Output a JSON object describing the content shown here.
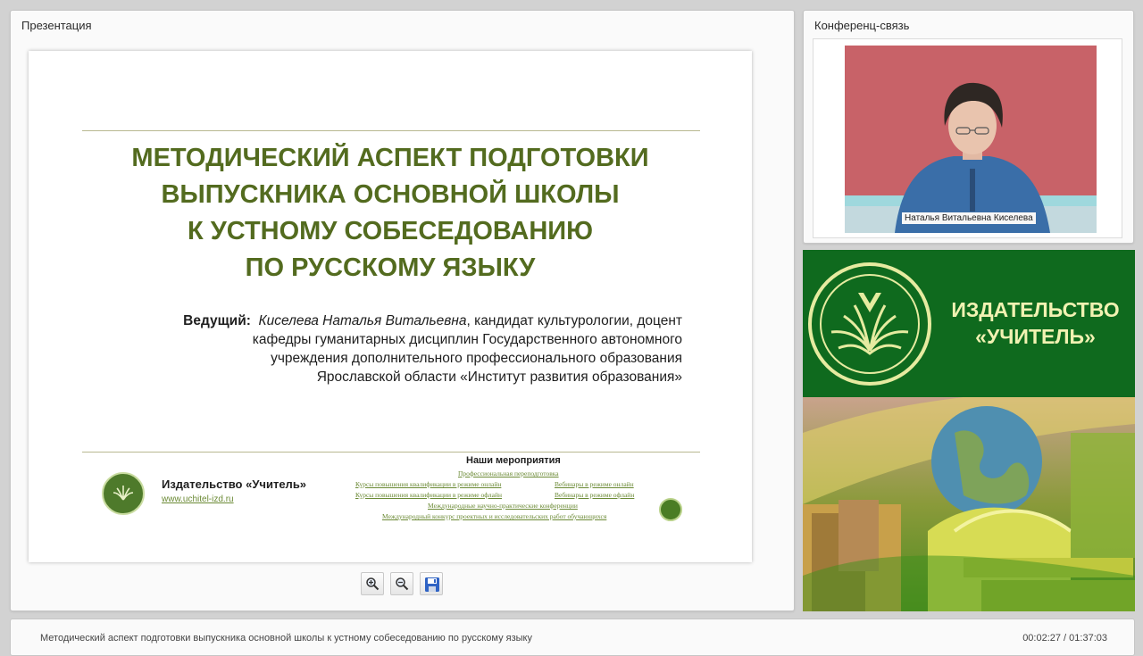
{
  "presentation_panel": {
    "title": "Презентация"
  },
  "slide": {
    "title_lines": [
      "МЕТОДИЧЕСКИЙ АСПЕКТ ПОДГОТОВКИ",
      "ВЫПУСКНИКА ОСНОВНОЙ ШКОЛЫ",
      "К УСТНОМУ СОБЕСЕДОВАНИЮ",
      "ПО РУССКОМУ ЯЗЫКУ"
    ],
    "presenter_label": "Ведущий:",
    "presenter_name": "Киселева Наталья Витальевна",
    "presenter_line1_rest": ", кандидат культурологии, доцент",
    "presenter_lines": [
      "кафедры гуманитарных дисциплин Государственного автономного",
      "учреждения дополнительного профессионального образования",
      "Ярославской области «Институт развития образования»"
    ],
    "publisher_name": "Издательство «Учитель»",
    "publisher_url": "www.uchitel-izd.ru",
    "events_title": "Наши мероприятия",
    "events": {
      "e1": "Профессиональная переподготовка",
      "e2": "Курсы повышения квалификации в режиме онлайн",
      "e3": "Вебинары в режиме онлайн",
      "e4": "Курсы повышения квалификации в режиме офлайн",
      "e5": "Вебинары в режиме офлайн",
      "e6": "Международные научно-практические конференции",
      "e7": "Международный конкурс проектных и исследовательских работ обучающихся"
    }
  },
  "toolbar": {
    "zoom_in_icon": "zoom-in-icon",
    "zoom_out_icon": "zoom-out-icon",
    "save_icon": "floppy-disk-icon"
  },
  "conference_panel": {
    "title": "Конференц-связь",
    "participant_name": "Наталья Витальевна Киселева"
  },
  "banner": {
    "line1": "ИЗДАТЕЛЬСТВО",
    "line2": "«УЧИТЕЛЬ»"
  },
  "status_bar": {
    "title": "Методический аспект подготовки выпускника основной школы к устному собеседованию по русскому языку",
    "time": "00:02:27 / 01:37:03"
  },
  "colors": {
    "slide_title": "#536b1f",
    "banner_green": "#0f6a1e",
    "banner_text": "#f1f2b2",
    "video_bg": "#c86268"
  }
}
